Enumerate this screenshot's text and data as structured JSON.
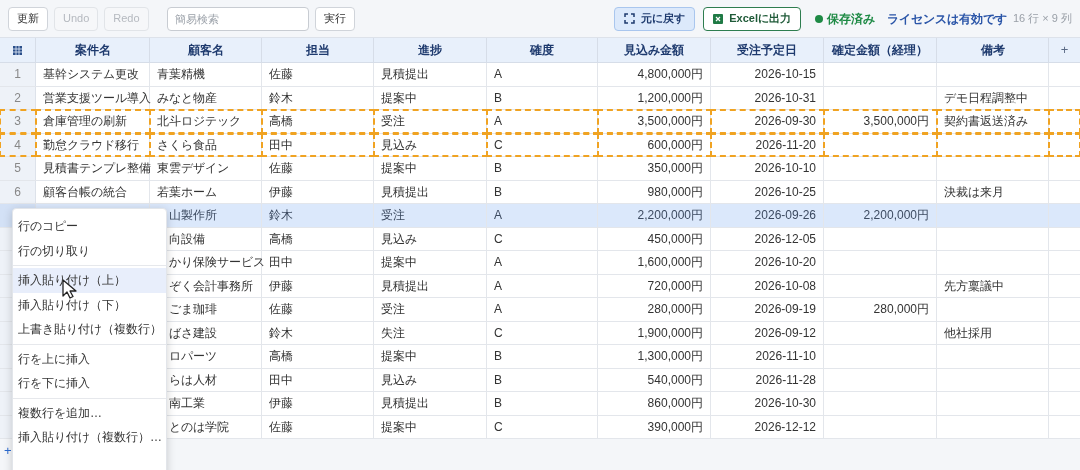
{
  "toolbar": {
    "buttons": [
      {
        "label": "更新",
        "disabled": false
      },
      {
        "label": "Undo",
        "disabled": true
      },
      {
        "label": "Redo",
        "disabled": true
      }
    ],
    "search": {
      "placeholder": "簡易検索"
    },
    "run_button": "実行",
    "restore_button": "元に戻す",
    "excel_button": "Excelに出力",
    "save_status": "保存済み",
    "license": "ライセンスは有効です",
    "dimensions": "16 行 × 9 列"
  },
  "table": {
    "columns": [
      "案件名",
      "顧客名",
      "担当",
      "進捗",
      "確度",
      "見込み金額",
      "受注予定日",
      "確定金額（経理）",
      "備考"
    ],
    "add_column": "+",
    "rows": [
      {
        "number": "1",
        "selected": false,
        "copied": false,
        "case": "基幹システム更改",
        "customer": "青葉精機",
        "owner": "佐藤",
        "progress": "見積提出",
        "certainty": "A",
        "expected": "4,800,000円",
        "date": "2026-10-15"
      },
      {
        "number": "2",
        "selected": false,
        "copied": false,
        "case": "営業支援ツール導入",
        "customer": "みなと物産",
        "owner": "鈴木",
        "progress": "提案中",
        "certainty": "B",
        "expected": "1,200,000円",
        "date": "2026-10-31",
        "note": "デモ日程調整中"
      },
      {
        "number": "3",
        "selected": false,
        "copied": true,
        "case": "倉庫管理の刷新",
        "customer": "北斗ロジテック",
        "owner": "高橋",
        "progress": "受注",
        "certainty": "A",
        "expected": "3,500,000円",
        "date": "2026-09-30",
        "confirmed": "3,500,000円",
        "note": "契約書返送済み"
      },
      {
        "number": "4",
        "selected": false,
        "copied": true,
        "case": "勤怠クラウド移行",
        "customer": "さくら食品",
        "owner": "田中",
        "progress": "見込み",
        "certainty": "C",
        "expected": "600,000円",
        "date": "2026-11-20"
      },
      {
        "number": "5",
        "selected": false,
        "copied": false,
        "case": "見積書テンプレ整備",
        "customer": "東雲デザイン",
        "owner": "佐藤",
        "progress": "提案中",
        "certainty": "B",
        "expected": "350,000円",
        "date": "2026-10-10"
      },
      {
        "number": "6",
        "selected": false,
        "copied": false,
        "case": "顧客台帳の統合",
        "customer": "若葉ホーム",
        "owner": "伊藤",
        "progress": "見積提出",
        "certainty": "B",
        "expected": "980,000円",
        "date": "2026-10-25",
        "note": "決裁は来月"
      },
      {
        "selected": true,
        "copied": false,
        "customer": "山製作所",
        "owner": "鈴木",
        "progress": "受注",
        "certainty": "A",
        "expected": "2,200,000円",
        "date": "2026-09-26",
        "confirmed": "2,200,000円"
      },
      {
        "selected": false,
        "copied": false,
        "customer": "向設備",
        "owner": "高橋",
        "progress": "見込み",
        "certainty": "C",
        "expected": "450,000円",
        "date": "2026-12-05"
      },
      {
        "selected": false,
        "copied": false,
        "customer": "かり保険サービス",
        "owner": "田中",
        "progress": "提案中",
        "certainty": "A",
        "expected": "1,600,000円",
        "date": "2026-10-20"
      },
      {
        "selected": false,
        "copied": false,
        "customer": "ぞく会計事務所",
        "owner": "伊藤",
        "progress": "見積提出",
        "certainty": "A",
        "expected": "720,000円",
        "date": "2026-10-08",
        "note": "先方稟議中"
      },
      {
        "selected": false,
        "copied": false,
        "customer": "ごま珈琲",
        "owner": "佐藤",
        "progress": "受注",
        "certainty": "A",
        "expected": "280,000円",
        "date": "2026-09-19",
        "confirmed": "280,000円"
      },
      {
        "selected": false,
        "copied": false,
        "customer": "ばさ建設",
        "owner": "鈴木",
        "progress": "失注",
        "certainty": "C",
        "expected": "1,900,000円",
        "date": "2026-09-12",
        "note": "他社採用"
      },
      {
        "selected": false,
        "copied": false,
        "customer": "ロパーツ",
        "owner": "高橋",
        "progress": "提案中",
        "certainty": "B",
        "expected": "1,300,000円",
        "date": "2026-11-10"
      },
      {
        "selected": false,
        "copied": false,
        "customer": "らは人材",
        "owner": "田中",
        "progress": "見込み",
        "certainty": "B",
        "expected": "540,000円",
        "date": "2026-11-28"
      },
      {
        "selected": false,
        "copied": false,
        "customer": "南工業",
        "owner": "伊藤",
        "progress": "見積提出",
        "certainty": "B",
        "expected": "860,000円",
        "date": "2026-10-30"
      },
      {
        "selected": false,
        "copied": false,
        "customer": "とのは学院",
        "owner": "佐藤",
        "progress": "提案中",
        "certainty": "C",
        "expected": "390,000円",
        "date": "2026-12-12"
      }
    ],
    "add_row": "+"
  },
  "context_menu": {
    "groups": [
      [
        {
          "label": "行のコピー",
          "selected": false
        },
        {
          "label": "行の切り取り",
          "selected": false
        }
      ],
      [
        {
          "label": "挿入貼り付け（上）",
          "selected": true
        },
        {
          "label": "挿入貼り付け（下）",
          "selected": false
        },
        {
          "label": "上書き貼り付け（複数行）",
          "selected": false
        }
      ],
      [
        {
          "label": "行を上に挿入",
          "selected": false
        },
        {
          "label": "行を下に挿入",
          "selected": false
        }
      ],
      [
        {
          "label": "複数行を追加…",
          "selected": false
        },
        {
          "label": "挿入貼り付け（複数行）…",
          "selected": false
        }
      ]
    ]
  }
}
